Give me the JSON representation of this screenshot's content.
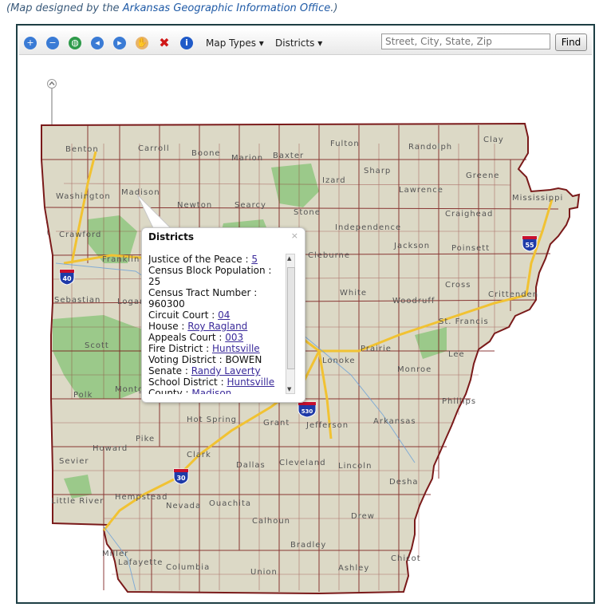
{
  "caption": {
    "prefix": "(Map designed by the ",
    "link": "Arkansas Geographic Information Office",
    "suffix": ".)"
  },
  "toolbar": {
    "map_types_label": "Map Types",
    "districts_label": "Districts",
    "search_placeholder": "Street, City, State, Zip",
    "find_label": "Find"
  },
  "highways": {
    "i40": "40",
    "i55": "55",
    "i30": "30",
    "i530": "530"
  },
  "counties": [
    "Benton",
    "Carroll",
    "Boone",
    "Marion",
    "Baxter",
    "Fulton",
    "Randolph",
    "Clay",
    "Washington",
    "Madison",
    "Newton",
    "Searcy",
    "Stone",
    "Izard",
    "Sharp",
    "Lawrence",
    "Greene",
    "Mississippi",
    "Crawford",
    "Franklin",
    "Independence",
    "Craighead",
    "Jackson",
    "Poinsett",
    "Sebastian",
    "Logan",
    "Cleburne",
    "White",
    "Cross",
    "Woodruff",
    "Crittenden",
    "St. Francis",
    "Lee",
    "Scott",
    "Prairie",
    "Lonoke",
    "Monroe",
    "Polk",
    "Montgomery",
    "Hot Spring",
    "Grant",
    "Jefferson",
    "Arkansas",
    "Phillips",
    "Pike",
    "Howard",
    "Clark",
    "Dallas",
    "Cleveland",
    "Lincoln",
    "Desha",
    "Sevier",
    "Little River",
    "Hempstead",
    "Nevada",
    "Ouachita",
    "Calhoun",
    "Drew",
    "Bradley",
    "Miller",
    "Lafayette",
    "Columbia",
    "Union",
    "Ashley",
    "Chicot"
  ],
  "popup": {
    "title": "Districts",
    "close": "×",
    "lines": [
      {
        "label": "Justice of the Peace : ",
        "value": "5",
        "link": true
      },
      {
        "label": "Census Block Population : ",
        "value": "25",
        "link": false
      },
      {
        "label": "Census Tract Number : ",
        "value": "960300",
        "link": false
      },
      {
        "label": "Circuit Court : ",
        "value": "04",
        "link": true
      },
      {
        "label": "House : ",
        "value": "Roy Ragland",
        "link": true
      },
      {
        "label": "Appeals Court : ",
        "value": "003",
        "link": true
      },
      {
        "label": "Fire District : ",
        "value": "Huntsville",
        "link": true
      },
      {
        "label": "Voting District : ",
        "value": "BOWEN",
        "link": false
      },
      {
        "label": "Senate : ",
        "value": "Randy Laverty",
        "link": true
      },
      {
        "label": "School District : ",
        "value": "Huntsville",
        "link": true
      },
      {
        "label": "County : ",
        "value": "Madison",
        "link": true
      }
    ]
  },
  "colors": {
    "land": "#dcd9c6",
    "forest": "#9bc98a",
    "county_border": "#7a1a1a",
    "highway": "#f1c232",
    "water": "#6ca0d8"
  }
}
